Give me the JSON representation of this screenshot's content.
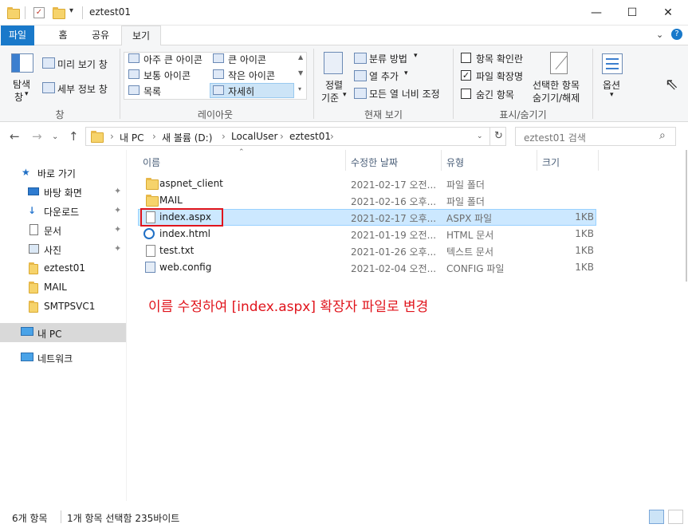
{
  "window": {
    "title": "eztest01",
    "minimize_glyph": "—",
    "maximize_glyph": "☐",
    "close_glyph": "✕"
  },
  "ribbon_tabs": [
    "파일",
    "홈",
    "공유",
    "보기"
  ],
  "ribbon": {
    "pane_group": {
      "navigation_pane_label": "탐색\n창",
      "navigation_pane_line1": "탐색",
      "navigation_pane_line2": "창",
      "preview_label": "미리 보기 창",
      "details_label": "세부 정보 창",
      "group_label": "창"
    },
    "layout_group": {
      "items": [
        "아주 큰 아이콘",
        "큰 아이콘",
        "보통 아이콘",
        "작은 아이콘",
        "목록",
        "자세히"
      ],
      "selected": "자세히",
      "group_label": "레이아웃"
    },
    "current_view_group": {
      "sort_line1": "정렬",
      "sort_line2": "기준",
      "group_by": "분류 방법",
      "add_columns": "열 추가",
      "size_all_columns": "모든 열 너비 조정",
      "group_label": "현재 보기"
    },
    "show_hide_group": {
      "item_checkboxes": "항목 확인란",
      "file_extensions": "파일 확장명",
      "hidden_items": "숨긴 항목",
      "hide_selected_line1": "선택한 항목",
      "hide_selected_line2": "숨기기/해제",
      "group_label": "표시/숨기기",
      "checked": [
        false,
        true,
        false
      ]
    },
    "options_label": "옵션"
  },
  "address": {
    "crumbs": [
      "내 PC",
      "새 볼륨 (D:)",
      "LocalUser",
      "eztest01"
    ],
    "search_placeholder": "eztest01 검색"
  },
  "nav": {
    "quick_access": "바로 가기",
    "items": [
      "바탕 화면",
      "다운로드",
      "문서",
      "사진",
      "eztest01",
      "MAIL",
      "SMTPSVC1"
    ],
    "this_pc": "내 PC",
    "network": "네트워크"
  },
  "columns": {
    "name": "이름",
    "modified": "수정한 날짜",
    "type": "유형",
    "size": "크기"
  },
  "files": [
    {
      "name": "aspnet_client",
      "modified": "2021-02-17 오전...",
      "type": "파일 폴더",
      "size": "",
      "icon": "folder-icon"
    },
    {
      "name": "MAIL",
      "modified": "2021-02-16 오후...",
      "type": "파일 폴더",
      "size": "",
      "icon": "folder-icon"
    },
    {
      "name": "index.aspx",
      "modified": "2021-02-17 오후...",
      "type": "ASPX 파일",
      "size": "1KB",
      "icon": "document-icon"
    },
    {
      "name": "index.html",
      "modified": "2021-01-19 오전...",
      "type": "HTML 문서",
      "size": "1KB",
      "icon": "html-document-icon"
    },
    {
      "name": "test.txt",
      "modified": "2021-01-26 오후...",
      "type": "텍스트 문서",
      "size": "1KB",
      "icon": "text-document-icon"
    },
    {
      "name": "web.config",
      "modified": "2021-02-04 오전...",
      "type": "CONFIG 파일",
      "size": "1KB",
      "icon": "config-file-icon"
    }
  ],
  "selected_file_index": 2,
  "annotation": "이름 수정하여 [index.aspx] 확장자 파일로 변경",
  "status": {
    "item_count": "6개 항목",
    "selection": "1개 항목 선택함 235바이트"
  },
  "colors": {
    "file_tab": "#1979ca",
    "selection": "#cce8ff",
    "annotation_red": "#e0141c"
  }
}
